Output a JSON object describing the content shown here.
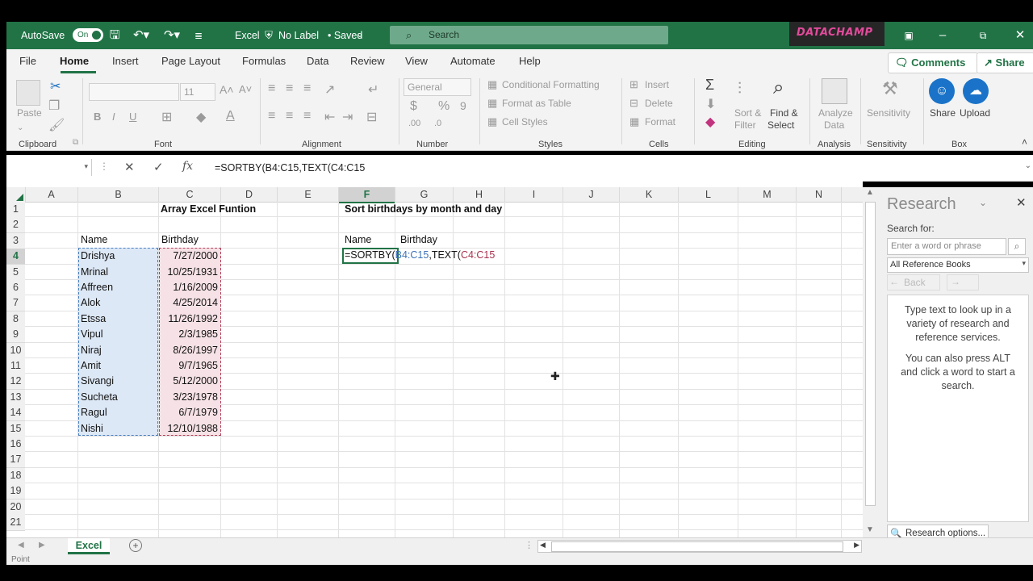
{
  "titlebar": {
    "autosave_label": "AutoSave",
    "autosave_state": "On",
    "filename": "Excel",
    "sensitivity": "No Label",
    "save_state": "• Saved",
    "search_placeholder": "Search",
    "brand": "DATACHAMP"
  },
  "menu": {
    "items": [
      "File",
      "Home",
      "Insert",
      "Page Layout",
      "Formulas",
      "Data",
      "Review",
      "View",
      "Automate",
      "Help"
    ],
    "active": "Home",
    "comments_label": "Comments",
    "share_label": "Share"
  },
  "ribbon": {
    "clipboard": {
      "paste_label": "Paste",
      "group_label": "Clipboard"
    },
    "font": {
      "font_size": "11",
      "group_label": "Font"
    },
    "alignment": {
      "group_label": "Alignment"
    },
    "number": {
      "format": "General",
      "group_label": "Number"
    },
    "styles": {
      "conditional_formatting": "Conditional Formatting",
      "format_as_table": "Format as Table",
      "cell_styles": "Cell Styles",
      "group_label": "Styles"
    },
    "cells": {
      "insert": "Insert",
      "delete": "Delete",
      "format": "Format",
      "group_label": "Cells"
    },
    "editing": {
      "sort_filter": "Sort &",
      "sort_filter_2": "Filter",
      "find_select": "Find &",
      "find_select_2": "Select",
      "group_label": "Editing"
    },
    "analysis": {
      "analyze_data": "Analyze",
      "analyze_data_2": "Data",
      "group_label": "Analysis"
    },
    "sensitivity": {
      "label": "Sensitivity",
      "group_label": "Sensitivity"
    },
    "box": {
      "share": "Share",
      "upload": "Upload",
      "group_label": "Box"
    }
  },
  "formula_bar": {
    "name_box": "",
    "formula": "=SORTBY(B4:C15,TEXT(C4:C15"
  },
  "sheet": {
    "columns": [
      "A",
      "B",
      "C",
      "D",
      "E",
      "F",
      "G",
      "H",
      "I",
      "J",
      "K",
      "L",
      "M",
      "N"
    ],
    "rows": [
      "1",
      "2",
      "3",
      "4",
      "5",
      "6",
      "7",
      "8",
      "9",
      "10",
      "11",
      "12",
      "13",
      "14",
      "15",
      "16",
      "17",
      "18",
      "19",
      "20",
      "21"
    ],
    "selected_column": "F",
    "selected_row": "4",
    "title_left": "Array Excel Funtion",
    "title_right": "Sort birthdays by month and day",
    "header_name": "Name",
    "header_birthday": "Birthday",
    "header_name_2": "Name",
    "header_birthday_2": "Birthday",
    "data": [
      {
        "name": "Drishya",
        "birthday": "7/27/2000"
      },
      {
        "name": "Mrinal",
        "birthday": "10/25/1931"
      },
      {
        "name": "Affreen",
        "birthday": "1/16/2009"
      },
      {
        "name": "Alok",
        "birthday": "4/25/2014"
      },
      {
        "name": "Etssa",
        "birthday": "11/26/1992"
      },
      {
        "name": "Vipul",
        "birthday": "2/3/1985"
      },
      {
        "name": "Niraj",
        "birthday": "8/26/1997"
      },
      {
        "name": "Amit",
        "birthday": "9/7/1965"
      },
      {
        "name": "Sivangi",
        "birthday": "5/12/2000"
      },
      {
        "name": "Sucheta",
        "birthday": "3/23/1978"
      },
      {
        "name": "Ragul",
        "birthday": "6/7/1979"
      },
      {
        "name": "Nishi",
        "birthday": "12/10/1988"
      }
    ],
    "edit_cell": {
      "part1": "=SORTBY(",
      "part2": "B4:C15",
      "part3": ",TEXT(",
      "part4": "C4:C15"
    }
  },
  "research": {
    "title": "Research",
    "search_for": "Search for:",
    "search_placeholder": "Enter a word or phrase",
    "source": "All Reference Books",
    "back": "Back",
    "info1": "Type text to look up in a variety of research and reference services.",
    "info2": "You can also press ALT and click a word to start a search.",
    "options": "Research options..."
  },
  "tabs": {
    "sheet_tab": "Excel"
  },
  "status": {
    "mode": "Point"
  },
  "colors": {
    "excel_green": "#217346",
    "range_blue": "#4a7fc0",
    "range_red": "#b0405a"
  }
}
